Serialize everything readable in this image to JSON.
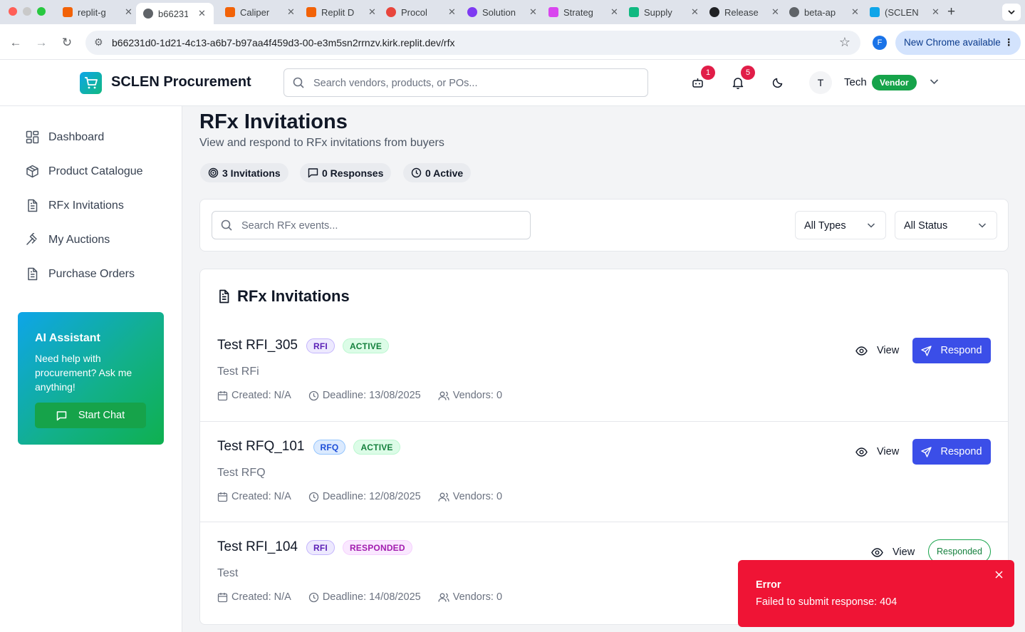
{
  "browser": {
    "tabs": [
      {
        "title": "replit-g",
        "favicon_color": "#f26207"
      },
      {
        "title": "b66231",
        "favicon_color": "#5f6368"
      },
      {
        "title": "Caliper",
        "favicon_color": "#f26207"
      },
      {
        "title": "Replit D",
        "favicon_color": "#f26207"
      },
      {
        "title": "Procol",
        "favicon_color": "#e8453c"
      },
      {
        "title": "Solution",
        "favicon_color": "#7e3af2"
      },
      {
        "title": "Strateg",
        "favicon_color": "#d946ef"
      },
      {
        "title": "Supply",
        "favicon_color": "#10b981"
      },
      {
        "title": "Release",
        "favicon_color": "#202124"
      },
      {
        "title": "beta-ap",
        "favicon_color": "#5f6368"
      },
      {
        "title": "(SCLEN",
        "favicon_color": "#0ea5e9"
      }
    ],
    "url": "b66231d0-1d21-4c13-a6b7-b97aa4f459d3-00-e3m5sn2rrnzv.kirk.replit.dev/rfx",
    "profile_initial": "F",
    "update_label": "New Chrome available"
  },
  "header": {
    "brand": "SCLEN Procurement",
    "search_placeholder": "Search vendors, products, or POs...",
    "robot_badge": "1",
    "notification_badge": "5",
    "avatar_initial": "T",
    "user_name": "Tech",
    "role": "Vendor"
  },
  "sidebar": {
    "items": [
      {
        "label": "Dashboard",
        "icon": "dashboard-icon"
      },
      {
        "label": "Product Catalogue",
        "icon": "package-icon"
      },
      {
        "label": "RFx Invitations",
        "icon": "file-text-icon"
      },
      {
        "label": "My Auctions",
        "icon": "gavel-icon"
      },
      {
        "label": "Purchase Orders",
        "icon": "file-text-icon"
      }
    ],
    "assistant": {
      "title": "AI Assistant",
      "description": "Need help with procurement? Ask me anything!",
      "button": "Start Chat"
    }
  },
  "page": {
    "title": "RFx Invitations",
    "subtitle": "View and respond to RFx invitations from buyers",
    "stats": {
      "invitations": "3 Invitations",
      "responses": "0 Responses",
      "active": "0 Active"
    }
  },
  "filters": {
    "search_placeholder": "Search RFx events...",
    "type_select": "All Types",
    "status_select": "All Status"
  },
  "list": {
    "heading": "RFx Invitations",
    "view_label": "View",
    "respond_label": "Respond",
    "responded_label": "Responded",
    "rows": [
      {
        "title": "Test RFI_305",
        "type": "RFI",
        "status": "ACTIVE",
        "description": "Test RFi",
        "created": "Created: N/A",
        "deadline": "Deadline: 13/08/2025",
        "vendors": "Vendors: 0"
      },
      {
        "title": "Test RFQ_101",
        "type": "RFQ",
        "status": "ACTIVE",
        "description": "Test RFQ",
        "created": "Created: N/A",
        "deadline": "Deadline: 12/08/2025",
        "vendors": "Vendors: 0"
      },
      {
        "title": "Test RFI_104",
        "type": "RFI",
        "status": "RESPONDED",
        "description": "Test",
        "created": "Created: N/A",
        "deadline": "Deadline: 14/08/2025",
        "vendors": "Vendors: 0"
      }
    ]
  },
  "toast": {
    "title": "Error",
    "message": "Failed to submit response: 404"
  },
  "colors": {
    "primary_button": "#3b4ee8",
    "vendor_badge": "#16a34a",
    "error_toast": "#ef1435",
    "notification_badge": "#e11d48"
  }
}
